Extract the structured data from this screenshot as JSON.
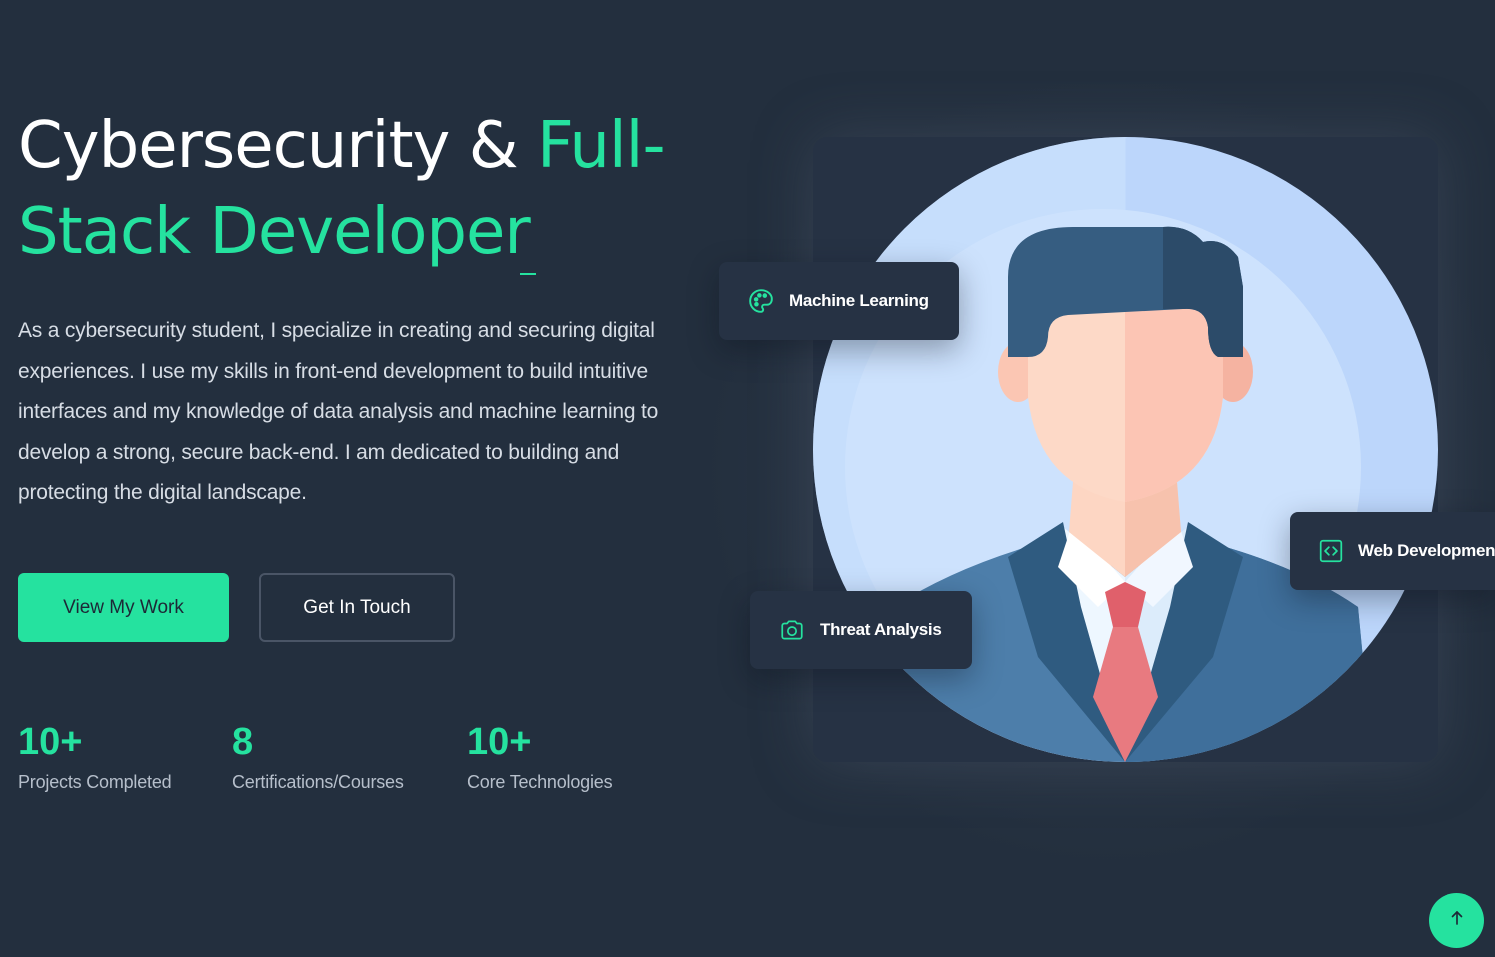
{
  "hero": {
    "title_part1": "Cybersecurity & ",
    "title_accent_line1": "Full-",
    "title_accent_line2": "Stack Developer",
    "description": "As a cybersecurity student, I specialize in creating and securing digital experiences. I use my skills in front-end development to build intuitive interfaces and my knowledge of data analysis and machine learning to develop a strong, secure back-end. I am dedicated to building and protecting the digital landscape."
  },
  "buttons": {
    "primary_label": "View My Work",
    "secondary_label": "Get In Touch"
  },
  "stats": [
    {
      "value": "10+",
      "label": "Projects Completed"
    },
    {
      "value": "8",
      "label": "Certifications/Courses"
    },
    {
      "value": "10+",
      "label": "Core Technologies"
    }
  ],
  "chips": {
    "machine_learning": {
      "label": "Machine Learning",
      "icon": "palette-icon"
    },
    "web_development": {
      "label": "Web Development",
      "icon": "code-icon"
    },
    "threat_analysis": {
      "label": "Threat Analysis",
      "icon": "camera-icon"
    }
  },
  "scroll_top": {
    "icon": "arrow-up-icon"
  },
  "colors": {
    "background": "#232f3e",
    "accent": "#25e29f",
    "card": "#263244"
  }
}
